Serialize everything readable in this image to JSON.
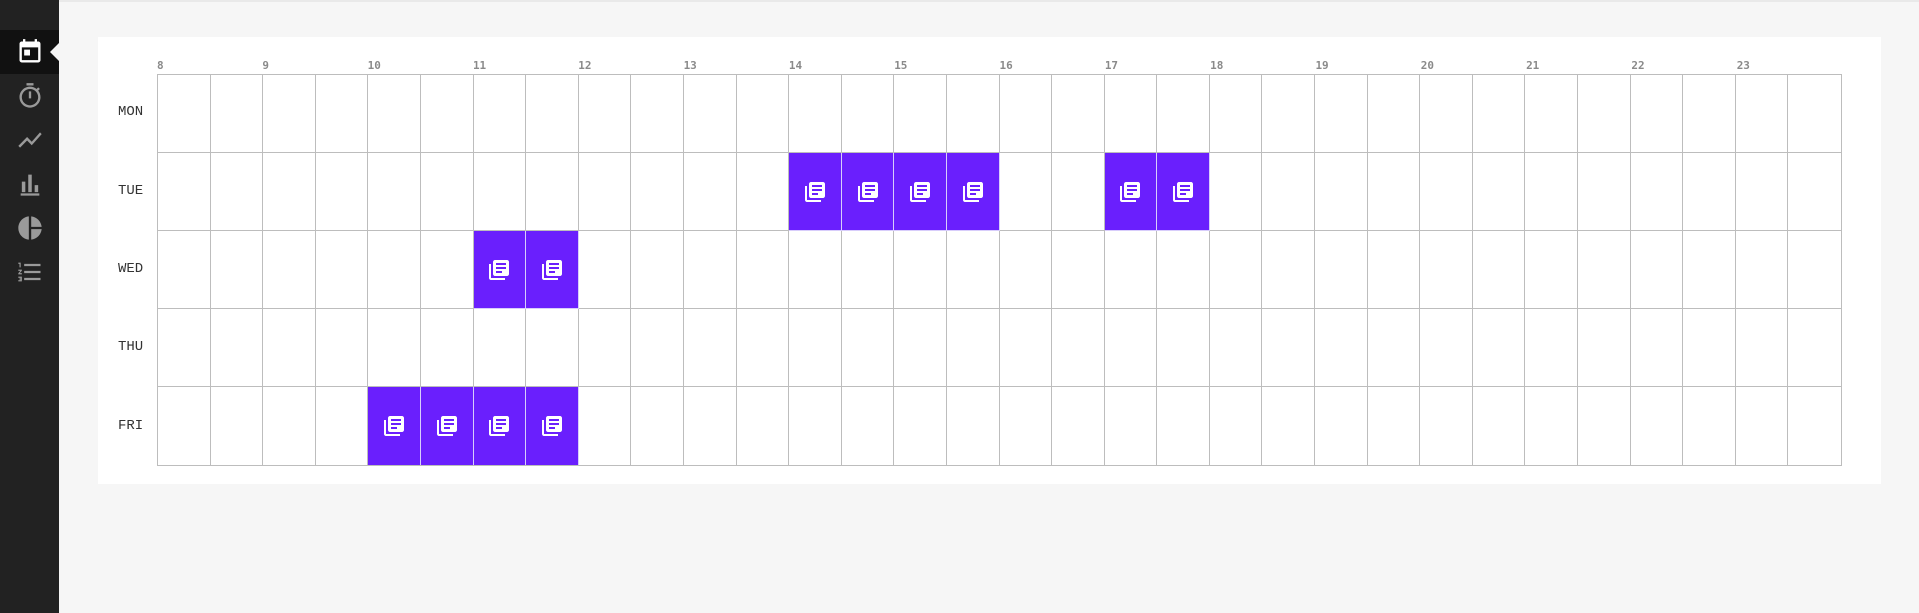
{
  "sidebar": {
    "items": [
      {
        "name": "calendar",
        "icon": "calendar-icon",
        "active": true
      },
      {
        "name": "timer",
        "icon": "timer-icon",
        "active": false
      },
      {
        "name": "trend",
        "icon": "line-chart-icon",
        "active": false
      },
      {
        "name": "bars",
        "icon": "bar-chart-icon",
        "active": false
      },
      {
        "name": "pie",
        "icon": "pie-chart-icon",
        "active": false
      },
      {
        "name": "list",
        "icon": "numbered-list-icon",
        "active": false
      }
    ]
  },
  "schedule": {
    "hours": [
      "8",
      "9",
      "10",
      "11",
      "12",
      "13",
      "14",
      "15",
      "16",
      "17",
      "18",
      "19",
      "20",
      "21",
      "22",
      "23"
    ],
    "days": [
      "MON",
      "TUE",
      "WED",
      "THU",
      "FRI"
    ],
    "slots_per_hour": 2,
    "filled_icon": "library-books-icon",
    "fill_color": "#6a1ffd",
    "filled": {
      "MON": [],
      "TUE": [
        12,
        13,
        14,
        15,
        18,
        19
      ],
      "WED": [
        6,
        7
      ],
      "THU": [],
      "FRI": [
        4,
        5,
        6,
        7
      ]
    }
  }
}
